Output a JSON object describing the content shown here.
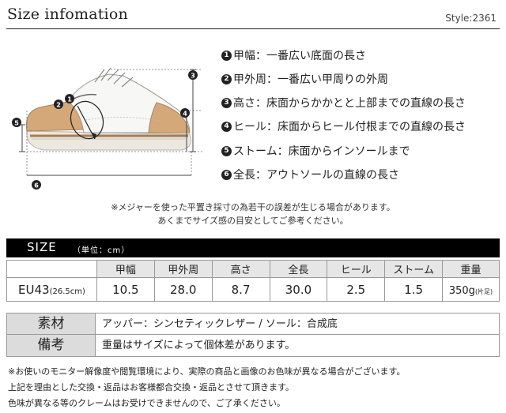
{
  "header": {
    "title": "Size infomation",
    "style": "Style:2361"
  },
  "legend": [
    {
      "num": "1",
      "text": "甲幅：一番広い底面の長さ"
    },
    {
      "num": "2",
      "text": "甲外周：一番広い甲周りの外周"
    },
    {
      "num": "3",
      "text": "高さ：床面からかかとと上部までの直線の長さ"
    },
    {
      "num": "4",
      "text": "ヒール：床面からヒール付根までの直線の長さ"
    },
    {
      "num": "5",
      "text": "ストーム：床面からインソールまで"
    },
    {
      "num": "6",
      "text": "全長：アウトソールの直線の長さ"
    }
  ],
  "diagram_markers": [
    "1",
    "2",
    "3",
    "4",
    "5",
    "6"
  ],
  "note": {
    "line1": "※メジャーを使った平置き採寸の為若干の誤差が生じる場合があります。",
    "line2": "あくまでサイズ感の目安としてご参考ください。"
  },
  "size_section": {
    "title": "SIZE",
    "unit": "（単位：cm）"
  },
  "size_table": {
    "headers": [
      "甲幅",
      "甲外周",
      "高さ",
      "全長",
      "ヒール",
      "ストーム",
      "重量"
    ],
    "row_label": "EU43",
    "row_sub": "(26.5cm)",
    "values": [
      "10.5",
      "28.0",
      "8.7",
      "30.0",
      "2.5",
      "1.5",
      "350g"
    ],
    "weight_note": "(片足)"
  },
  "material": {
    "rows": [
      {
        "label": "素材",
        "value": "アッパー：シンセティックレザー / ソール：合成底"
      },
      {
        "label": "備考",
        "value": "重量はサイズによって個体差があります。"
      }
    ]
  },
  "footer": {
    "line1": "※お使いのモニター解像度や閲覧環境により、実際の商品と画像のお色味が異なる場合がございます。",
    "line2": "上記を理由とした交換・返品はお客様都合交換・返品とさせて頂きます。",
    "line3": "色味が異なる等のクレームはお受けできませんので、ご了承ください。"
  },
  "colors": {
    "shoe_upper": "#f7f7f5",
    "shoe_tan": "#d4a878",
    "sole_gum": "#a67c52",
    "header_bg": "#000000",
    "table_head_bg": "#e6e6e6"
  }
}
